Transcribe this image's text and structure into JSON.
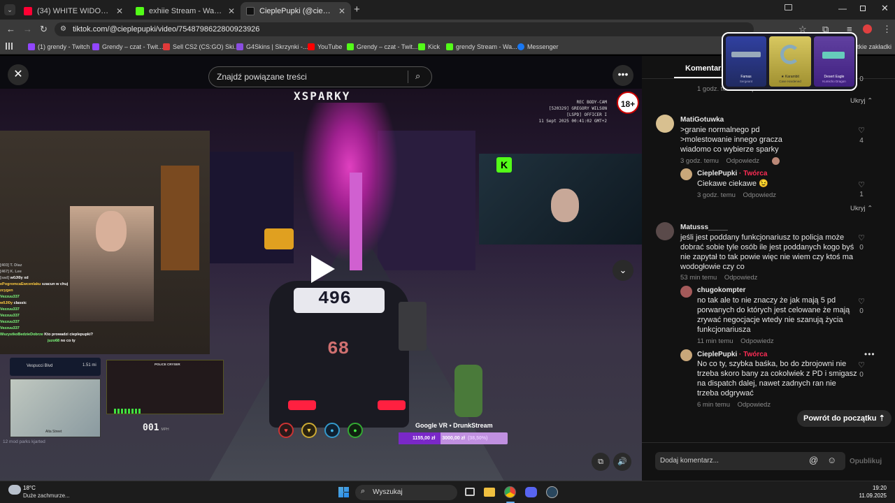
{
  "browser": {
    "tabs": [
      {
        "title": "(34) WHITE WIDOW - SHINJUKU",
        "fav_color": "#ff0033"
      },
      {
        "title": "exhiie Stream - Watch Live on K",
        "fav_color": "#53fc18"
      },
      {
        "title": "CieplePupki (@cieplepupki) | Ti",
        "fav_color": "#111111"
      }
    ],
    "new_tab": "+",
    "url": "tiktok.com/@cieplepupki/video/7548798622800923926",
    "bookmarks": [
      {
        "label": "(1) grendy - Twitch",
        "color": "#9146ff"
      },
      {
        "label": "Grendy – czat - Twit...",
        "color": "#9146ff"
      },
      {
        "label": "Sell CS2 (CS:GO) Ski...",
        "color": "#e03a3a"
      },
      {
        "label": "G4Skins | Skrzynki -...",
        "color": "#8a4de0"
      },
      {
        "label": "YouTube",
        "color": "#ff0000"
      },
      {
        "label": "Grendy – czat - Twit...",
        "color": "#53fc18"
      },
      {
        "label": "Kick",
        "color": "#53fc18"
      },
      {
        "label": "grendy Stream - Wa...",
        "color": "#53fc18"
      },
      {
        "label": "Messenger",
        "color": "#1877f2"
      }
    ],
    "other_bookmarks": "tkie zakładki"
  },
  "video": {
    "search_placeholder": "Znajdź powiązane treści",
    "overlay_name": "XSPARKY",
    "age_badge": "18+",
    "bodycam": [
      "REC                      BODY-CAM",
      "[520329] GREGORY WILSON",
      "[LSPD] OFFICER I",
      "11 Sept 2025 00:41:02 GMT+2"
    ],
    "car_number_roof": "496",
    "car_number_trunk": "68",
    "donation_label": "Google VR • DrunkStream",
    "donation_values": [
      "1155,00 zł",
      "3000,00 zł",
      "(38,50%)"
    ],
    "speed": "001",
    "speed_unit": "MPH",
    "street": "Vespucci Blvd",
    "distance": "1.51 mi",
    "street2": "Alta Street",
    "police_panel": "POLICE CRYSER",
    "footer_text": "12 mod parks kjarted",
    "chat_lines": [
      {
        "user": "[403] T. Diaz",
        "msg": ""
      },
      {
        "user": "[467] K. Lee",
        "msg": ""
      },
      {
        "user": "[sad]",
        "msg": "w0Jl0y xd"
      },
      {
        "user": "ePogromcaEwcenlaku",
        "msg": "szacun w chuj"
      },
      {
        "user": "zcygen",
        "msg": ""
      },
      {
        "user": "Vezzuu337",
        "msg": ""
      },
      {
        "user": "w0Jl0y",
        "msg": "classic"
      },
      {
        "user": "Vezzuu337",
        "msg": ""
      },
      {
        "user": "Vezzuu337",
        "msg": ""
      },
      {
        "user": "Vezzuu337",
        "msg": ""
      },
      {
        "user": "Vezzuu337",
        "msg": ""
      },
      {
        "user": "WszystkoBedzieDobrze",
        "msg": "Kto prowadzi cieplepupki?"
      },
      {
        "user": "juzo68",
        "msg": "no co ty"
      }
    ]
  },
  "comments_panel": {
    "tab_label": "Komentarze",
    "top_partial_text": "",
    "top_partial_meta": "1 godz. temu",
    "top_partial_reply": "Odpowiedz",
    "hide_label": "Ukryj",
    "comments": [
      {
        "user": "MatiGotuwka",
        "text": [
          ">granie normalnego pd",
          ">molestowanie innego gracza",
          "wiadomo co wybierze sparky"
        ],
        "time": "3 godz. temu",
        "reply": "Odpowiedz",
        "likes": "4"
      },
      {
        "user": "CieplePupki",
        "creator": "· Twórca",
        "text": [
          "Ciekawe ciekawe 😉"
        ],
        "time": "3 godz. temu",
        "reply": "Odpowiedz",
        "likes": "1"
      },
      {
        "user": "Matusss_____",
        "text": [
          "jeśli jest poddany funkcjonariusz to policja może",
          "dobrać sobie tyle osób ile jest poddanych kogo byś",
          "nie zapytał to tak powie więc nie wiem czy ktoś ma",
          "wodogłowie czy co"
        ],
        "time": "53 min temu",
        "reply": "Odpowiedz",
        "likes": "0"
      },
      {
        "user": "chugokompter",
        "text": [
          "no tak ale to nie znaczy że jak mają 5 pd",
          "porwanych do których jest celowane że mają",
          "zrywać negocjacje wtedy nie szanują życia",
          "funkcjonariusza"
        ],
        "time": "11 min temu",
        "reply": "Odpowiedz",
        "likes": "0"
      },
      {
        "user": "CieplePupki",
        "creator": "· Twórca",
        "text": [
          "No co ty, szybka baśka, bo do zbrojowni nie",
          "trzeba skoro bany za cokolwiek z PD i smigasz",
          "na dispatch dalej, nawet zadnych ran nie",
          "trzeba odgrywać"
        ],
        "time": "6 min temu",
        "reply": "Odpowiedz",
        "likes": "0"
      }
    ],
    "back_to_top": "Powrót do początku",
    "comment_placeholder": "Dodaj komentarz...",
    "publish": "Opublikuj"
  },
  "popup_skins": [
    {
      "name": "Famas",
      "sub": "Sergeant"
    },
    {
      "name": "★ Karambit",
      "sub": "Case Hardened"
    },
    {
      "name": "Desert Eagle",
      "sub": "Kumicho Dragon"
    }
  ],
  "taskbar": {
    "weather_temp": "18°C",
    "weather_desc": "Duże zachmurze...",
    "search_label": "Wyszukaj",
    "time": "19:20",
    "date": "11.09.2025"
  }
}
